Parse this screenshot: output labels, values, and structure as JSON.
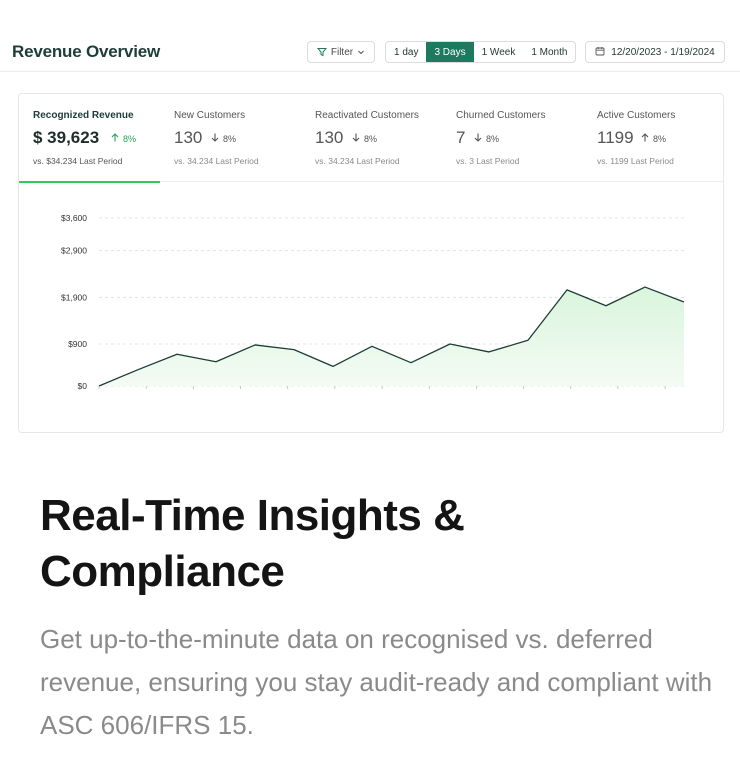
{
  "header": {
    "title": "Revenue Overview",
    "filter_label": "Filter",
    "ranges": [
      "1 day",
      "3 Days",
      "1 Week",
      "1 Month"
    ],
    "active_range": "3 Days",
    "date_range": "12/20/2023 - 1/19/2024"
  },
  "metrics": [
    {
      "label": "Recognized Revenue",
      "value": "$ 39,623",
      "change": "8%",
      "direction": "up",
      "previous": "vs. $34.234 Last Period",
      "active": true
    },
    {
      "label": "New Customers",
      "value": "130",
      "change": "8%",
      "direction": "down",
      "previous": "vs. 34.234 Last Period",
      "active": false
    },
    {
      "label": "Reactivated Customers",
      "value": "130",
      "change": "8%",
      "direction": "down",
      "previous": "vs. 34.234 Last Period",
      "active": false
    },
    {
      "label": "Churned Customers",
      "value": "7",
      "change": "8%",
      "direction": "down",
      "previous": "vs. 3 Last Period",
      "active": false
    },
    {
      "label": "Active Customers",
      "value": "1199",
      "change": "8%",
      "direction": "up",
      "previous": "vs. 1199 Last Period",
      "active": false
    }
  ],
  "chart_data": {
    "type": "area",
    "y_ticks": [
      "$3,600",
      "$2,900",
      "$1,900",
      "$900",
      "$0"
    ],
    "y_tick_values": [
      3600,
      2900,
      1900,
      900,
      0
    ],
    "ylim": [
      0,
      3600
    ],
    "grid": true,
    "series": [
      {
        "values": [
          0,
          350,
          680,
          520,
          880,
          780,
          420,
          850,
          500,
          900,
          730,
          980,
          2060,
          1720,
          2120,
          1800
        ]
      }
    ],
    "colors": {
      "line": "#1d3d36",
      "fill_top": "#d9f5dc",
      "fill_bottom": "#f4fbf4",
      "grid": "#dedede"
    }
  },
  "colors": {
    "accent": "#1d7a5f",
    "positive": "#23a35a",
    "tab_underline": "#2ecc5a"
  },
  "hero": {
    "headline": "Real-Time Insights & Compliance",
    "body": "Get up-to-the-minute data on recognised vs. deferred revenue, ensuring you stay audit-ready and compliant with ASC 606/IFRS 15."
  }
}
